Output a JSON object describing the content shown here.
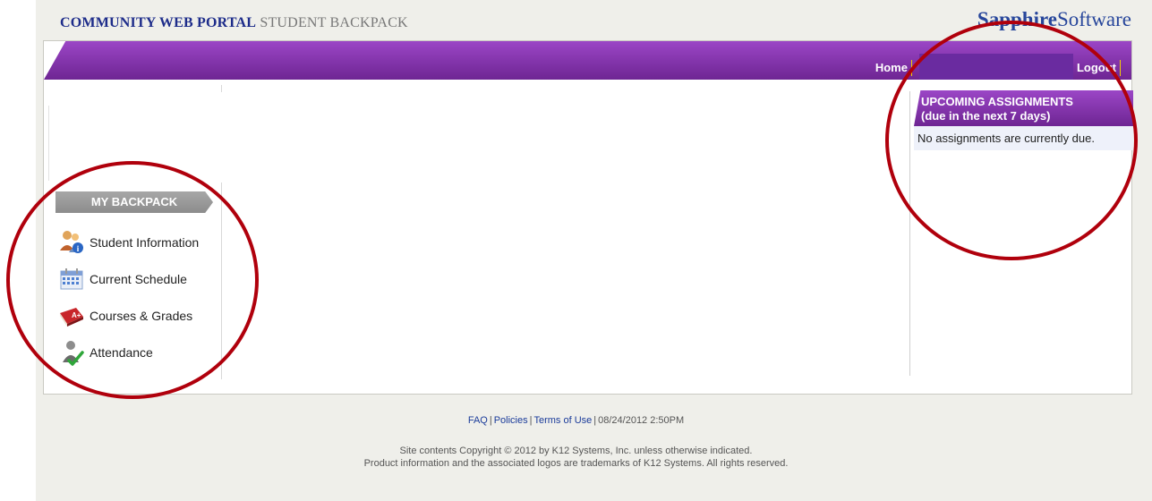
{
  "header": {
    "brand": "COMMUNITY WEB PORTAL",
    "section": "STUDENT BACKPACK"
  },
  "vendor": {
    "part1": "Sapphire",
    "part2": "Software"
  },
  "nav": {
    "home": "Home",
    "logout": "Logout"
  },
  "backpack": {
    "title": "MY BACKPACK",
    "items": [
      {
        "label": "Student Information",
        "icon": "student-info-icon"
      },
      {
        "label": "Current Schedule",
        "icon": "calendar-icon"
      },
      {
        "label": "Courses & Grades",
        "icon": "grades-book-icon"
      },
      {
        "label": "Attendance",
        "icon": "attendance-icon"
      }
    ]
  },
  "assignments": {
    "title_line1": "UPCOMING ASSIGNMENTS",
    "title_line2": "(due in the next 7 days)",
    "empty_message": "No assignments are currently due."
  },
  "footer": {
    "faq": "FAQ",
    "policies": "Policies",
    "terms": "Terms of Use",
    "timestamp": "08/24/2012 2:50PM",
    "copyright_line1": "Site contents Copyright © 2012 by K12 Systems, Inc. unless otherwise indicated.",
    "copyright_line2": "Product information and the associated logos are trademarks of K12 Systems.  All rights reserved."
  },
  "colors": {
    "accent": "#7a2ea6",
    "annotation": "#b0000c",
    "brand": "#1d2c8a"
  }
}
